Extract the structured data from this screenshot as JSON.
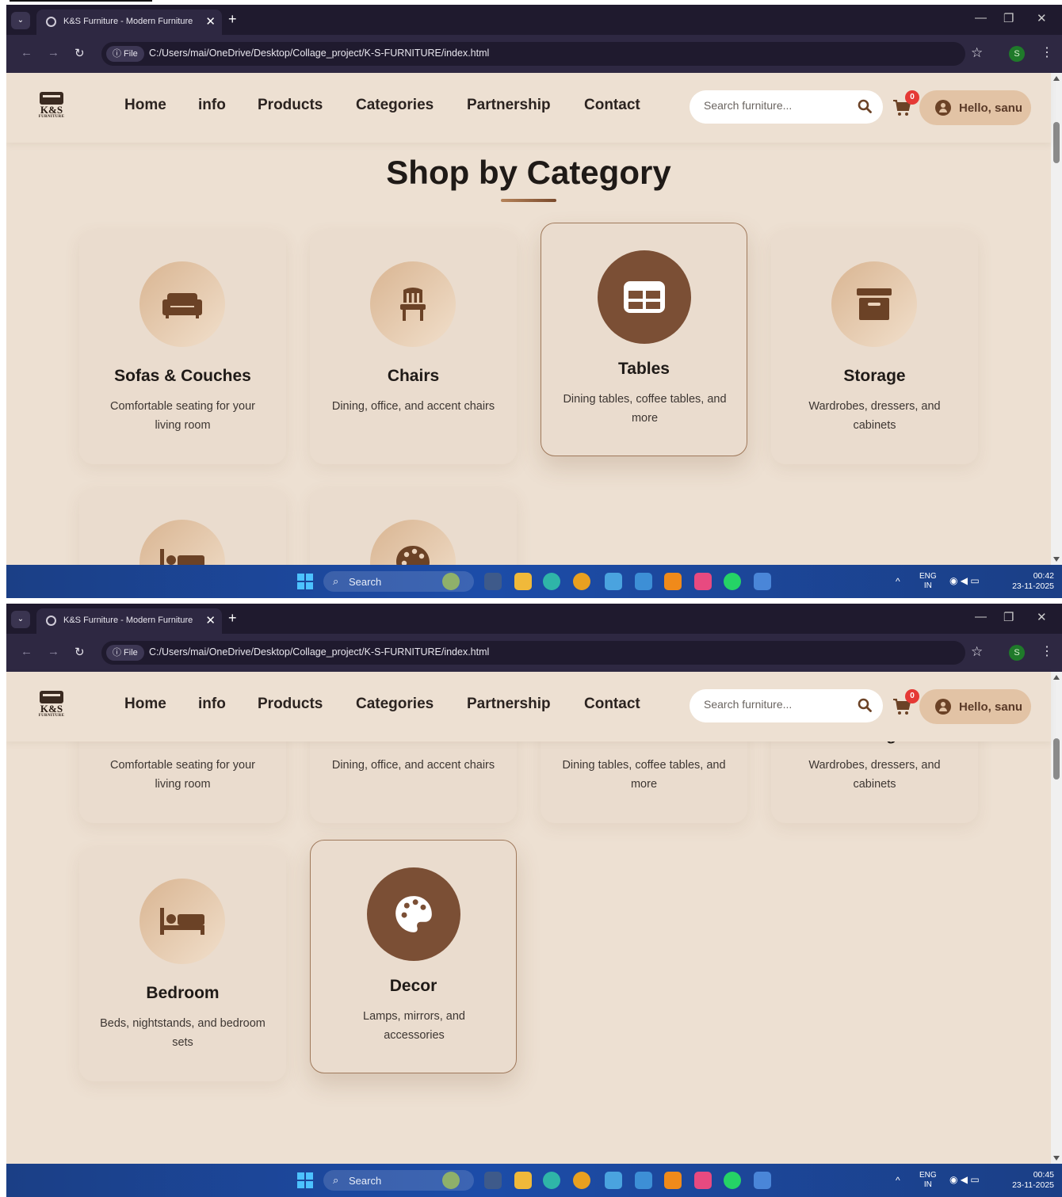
{
  "browser": {
    "tab_title": "K&S Furniture - Modern Furniture",
    "tab_close": "✕",
    "new_tab": "+",
    "file_chip": "ⓘ File",
    "url": "C:/Users/mai/OneDrive/Desktop/Collage_project/K-S-FURNITURE/index.html",
    "profile_initial": "S"
  },
  "header": {
    "logo_text": "K&S",
    "logo_sub": "FURNITURE",
    "nav": [
      "Home",
      "info",
      "Products",
      "Categories",
      "Partnership",
      "Contact"
    ],
    "search_placeholder": "Search furniture...",
    "cart_count": "0",
    "user_greeting": "Hello, sanu"
  },
  "section": {
    "title": "Shop by Category"
  },
  "categories": [
    {
      "name": "Sofas & Couches",
      "desc": "Comfortable seating for your living room",
      "icon": "sofa-icon"
    },
    {
      "name": "Chairs",
      "desc": "Dining, office, and accent chairs",
      "icon": "chair-icon"
    },
    {
      "name": "Tables",
      "desc": "Dining tables, coffee tables, and more",
      "icon": "table-icon"
    },
    {
      "name": "Storage",
      "desc": "Wardrobes, dressers, and cabinets",
      "icon": "archive-icon"
    },
    {
      "name": "Bedroom",
      "desc": "Beds, nightstands, and bedroom sets",
      "icon": "bed-icon"
    },
    {
      "name": "Decor",
      "desc": "Lamps, mirrors, and accessories",
      "icon": "palette-icon"
    }
  ],
  "taskbar": {
    "search_label": "Search",
    "lang_top": "ENG",
    "lang_bottom": "IN",
    "time_1": "00:42",
    "time_2": "00:45",
    "date": "23-11-2025"
  },
  "colors": {
    "page_bg": "#ede0d2",
    "accent_brown": "#7b4f35",
    "icon_brown": "#6b4226",
    "badge_red": "#e53935"
  }
}
